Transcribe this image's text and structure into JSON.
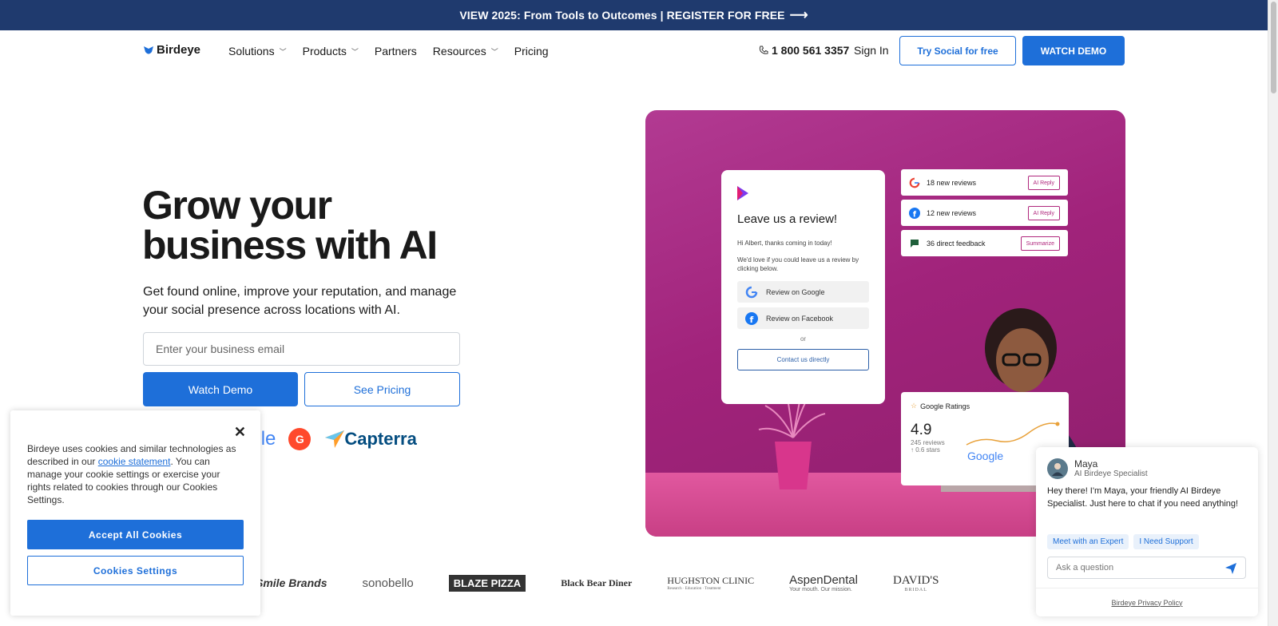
{
  "announcement": {
    "text": "VIEW 2025: From Tools to Outcomes | REGISTER FOR FREE",
    "arrow": "⟶"
  },
  "nav": {
    "logo": "Birdeye",
    "items": [
      {
        "label": "Solutions",
        "dropdown": true
      },
      {
        "label": "Products",
        "dropdown": true
      },
      {
        "label": "Partners",
        "dropdown": false
      },
      {
        "label": "Resources",
        "dropdown": true
      },
      {
        "label": "Pricing",
        "dropdown": false
      }
    ],
    "phone": "1 800 561 3357",
    "signin": "Sign In",
    "try_button": "Try Social for free",
    "demo_button": "WATCH DEMO"
  },
  "hero": {
    "title_line1": "Grow your",
    "title_line2": "business with AI",
    "subtitle": "Get found online, improve your reputation, and manage your social presence across locations with AI.",
    "email_placeholder": "Enter your business email",
    "watch_demo": "Watch Demo",
    "see_pricing": "See Pricing",
    "badges": {
      "google": "ogle",
      "g2": "G",
      "capterra": "Capterra"
    }
  },
  "illustration": {
    "review_card": {
      "title": "Leave us a review!",
      "greeting": "Hi Albert, thanks coming in today!",
      "body": "We'd love if you could leave us a review by clicking below.",
      "google_button": "Review on Google",
      "facebook_button": "Review on Facebook",
      "or": "or",
      "contact": "Contact us directly"
    },
    "mini_cards": [
      {
        "label": "18 new reviews",
        "tag": "AI Reply",
        "icon": "google-icon"
      },
      {
        "label": "12 new reviews",
        "tag": "AI Reply",
        "icon": "facebook-icon"
      },
      {
        "label": "36 direct feedback",
        "tag": "Summarize",
        "icon": "message-icon"
      }
    ],
    "ratings": {
      "title": "Google Ratings",
      "value": "4.9",
      "reviews": "245 reviews",
      "delta": "↑ 0.6 stars",
      "brand": "Google"
    }
  },
  "logos": [
    "Smile Brands",
    "sonobello",
    "BLAZE PIZZA",
    "Black Bear Diner",
    "HUGHSTON CLINIC",
    "AspenDental",
    "DAVID'S"
  ],
  "logo_subtexts": {
    "hughston": "Research · Education · Treatment",
    "aspen": "Your mouth. Our mission.",
    "davids": "BRIDAL"
  },
  "cookie": {
    "text_before": "Birdeye uses cookies and similar technologies as described in our ",
    "link": "cookie statement",
    "text_after": ". You can manage your cookie settings or exercise your rights related to cookies through our Cookies Settings.",
    "accept": "Accept All Cookies",
    "settings": "Cookies Settings",
    "close": "✕"
  },
  "chat": {
    "name": "Maya",
    "role": "AI Birdeye Specialist",
    "message": "Hey there! I'm Maya, your friendly AI Birdeye Specialist. Just here to chat if you need anything!",
    "chips": [
      "Meet with an Expert",
      "I Need Support"
    ],
    "placeholder": "Ask a question",
    "footer": "Birdeye Privacy Policy"
  },
  "colors": {
    "primary": "#1e6fd9",
    "banner": "#1f3a6e",
    "hero_bg": "#a1237b"
  }
}
